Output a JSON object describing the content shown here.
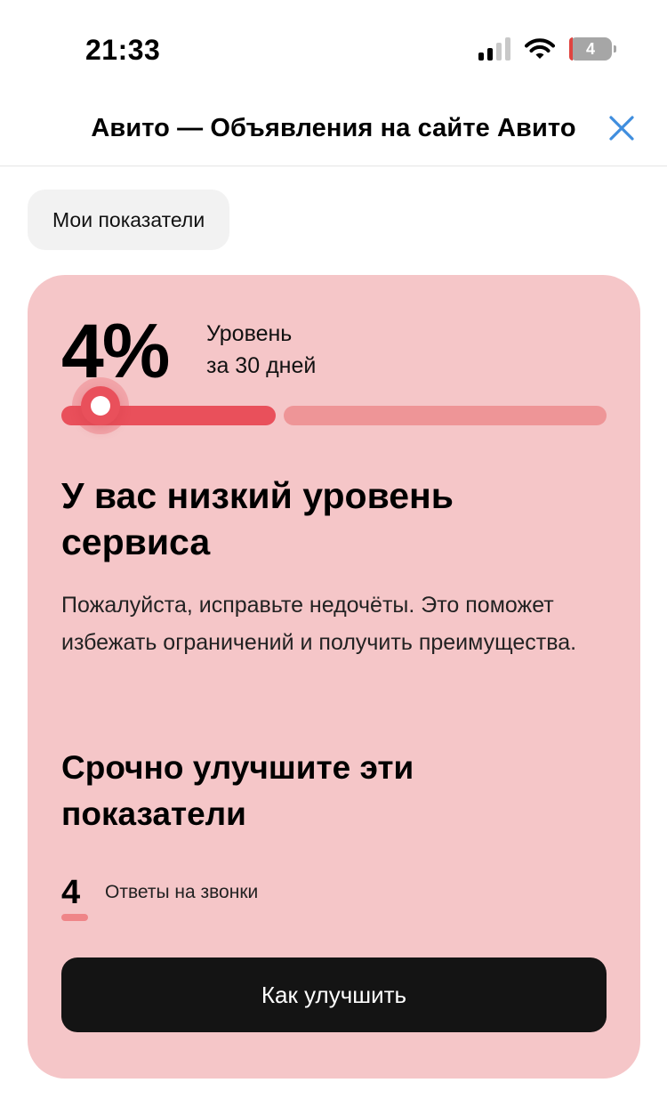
{
  "status_bar": {
    "time": "21:33",
    "battery_level": "4",
    "icons": [
      "signal-icon",
      "wifi-icon",
      "battery-icon"
    ]
  },
  "header": {
    "title": "Авито — Объявления на сайте Авито",
    "close_icon": "close-icon"
  },
  "chip": {
    "label": "Мои показатели"
  },
  "card": {
    "level_percent": "4%",
    "level_caption_line1": "Уровень",
    "level_caption_line2": "за 30 дней",
    "progress_fraction": 0.04,
    "heading": "У вас низкий уровень сервиса",
    "text": "Пожалуйста, исправьте недочёты. Это поможет избежать ограничений и получить преимущества.",
    "subheading": "Срочно улучшите эти показатели",
    "metrics": [
      {
        "value": "4",
        "label": "Ответы на звонки"
      }
    ],
    "button_label": "Как улучшить"
  },
  "colors": {
    "card_background": "#f5c6c8",
    "accent_red": "#e9505b",
    "progress_rest": "#ee9597",
    "button_background": "#141414",
    "close_icon": "#3f8ede"
  }
}
